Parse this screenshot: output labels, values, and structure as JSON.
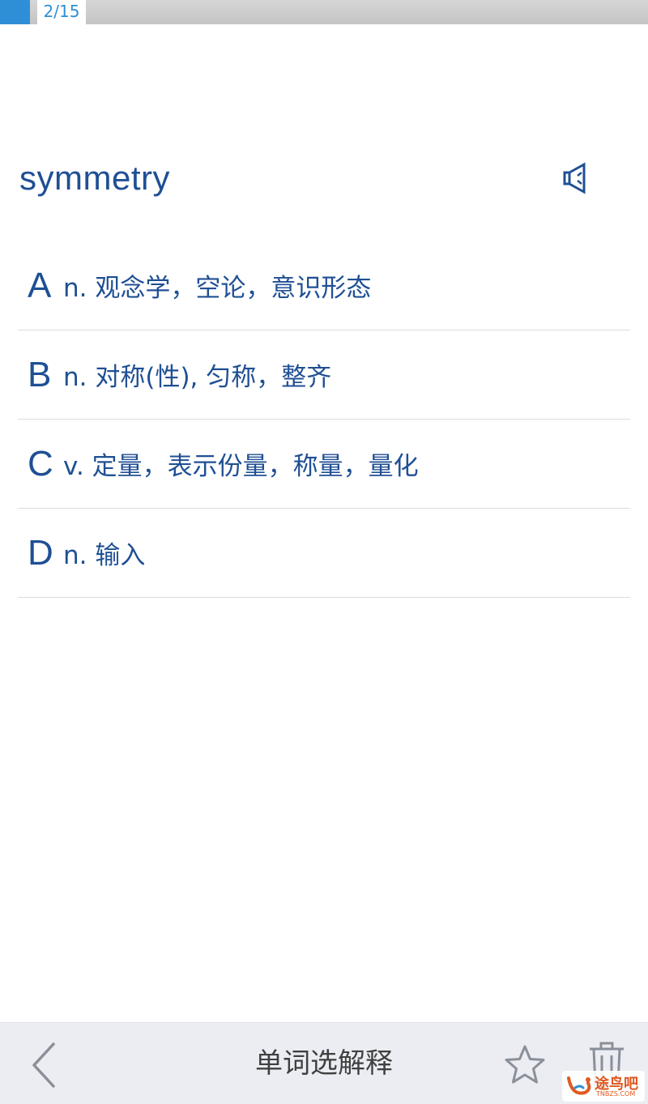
{
  "progress": {
    "label": "2/15",
    "current": 2,
    "total": 15,
    "fill_color": "#2f8fd6"
  },
  "word": {
    "text": "symmetry",
    "speaker_icon": "speaker-icon"
  },
  "options": [
    {
      "letter": "A",
      "text": "n. 观念学，空论，意识形态"
    },
    {
      "letter": "B",
      "text": "n. 对称(性), 匀称，整齐"
    },
    {
      "letter": "C",
      "text": "v. 定量，表示份量，称量，量化"
    },
    {
      "letter": "D",
      "text": "n. 输入"
    }
  ],
  "bottom_bar": {
    "title": "单词选解释",
    "back_icon": "chevron-left-icon",
    "star_icon": "star-icon",
    "trash_icon": "trash-icon"
  },
  "watermark": {
    "text": "途鸟吧",
    "sub": "TNBZS.COM"
  },
  "colors": {
    "accent": "#1f4f94",
    "progress": "#2f8fd6",
    "bar_bg": "#ebedf2"
  }
}
